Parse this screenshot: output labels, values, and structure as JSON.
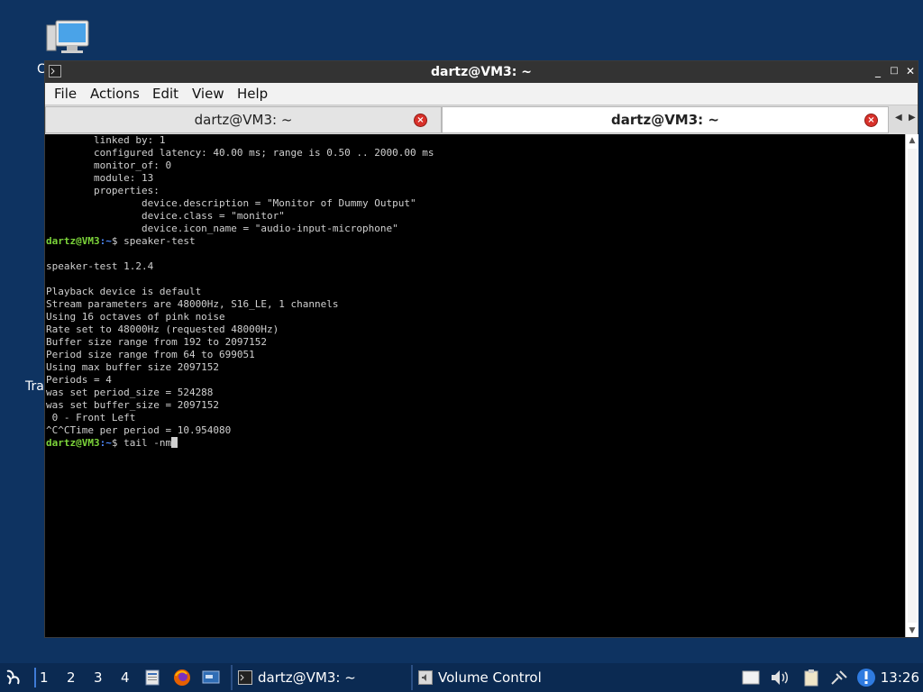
{
  "desktop": {
    "icon_label_partial": "C",
    "trash_label_partial": "Tra"
  },
  "window": {
    "title": "dartz@VM3: ~",
    "menu": [
      "File",
      "Actions",
      "Edit",
      "View",
      "Help"
    ],
    "tabs": [
      {
        "label": "dartz@VM3: ~",
        "active": false
      },
      {
        "label": "dartz@VM3: ~",
        "active": true
      }
    ],
    "terminal": {
      "lines": [
        "        linked by: 1",
        "        configured latency: 40.00 ms; range is 0.50 .. 2000.00 ms",
        "        monitor_of: 0",
        "        module: 13",
        "        properties:",
        "                device.description = \"Monitor of Dummy Output\"",
        "                device.class = \"monitor\"",
        "                device.icon_name = \"audio-input-microphone\""
      ],
      "prompt1": {
        "user": "dartz@VM3",
        "path": ":~",
        "sym": "$ ",
        "cmd": "speaker-test"
      },
      "output": [
        "",
        "speaker-test 1.2.4",
        "",
        "Playback device is default",
        "Stream parameters are 48000Hz, S16_LE, 1 channels",
        "Using 16 octaves of pink noise",
        "Rate set to 48000Hz (requested 48000Hz)",
        "Buffer size range from 192 to 2097152",
        "Period size range from 64 to 699051",
        "Using max buffer size 2097152",
        "Periods = 4",
        "was set period_size = 524288",
        "was set buffer_size = 2097152",
        " 0 - Front Left",
        "^C^CTime per period = 10.954080"
      ],
      "prompt2": {
        "user": "dartz@VM3",
        "path": ":~",
        "sym": "$ ",
        "cmd": "tail -nm"
      }
    }
  },
  "taskbar": {
    "workspaces": [
      "1",
      "2",
      "3",
      "4"
    ],
    "tasks": [
      {
        "label": "dartz@VM3: ~",
        "icon": "terminal-icon"
      },
      {
        "label": "Volume Control",
        "icon": "volume-control-icon"
      }
    ],
    "clock": "13:26"
  },
  "colors": {
    "desktop_bg": "#0e3361",
    "taskbar_bg": "#0b2a52",
    "prompt_user": "#7cd43a",
    "prompt_path": "#4f8bff",
    "close_red": "#d8312a"
  }
}
